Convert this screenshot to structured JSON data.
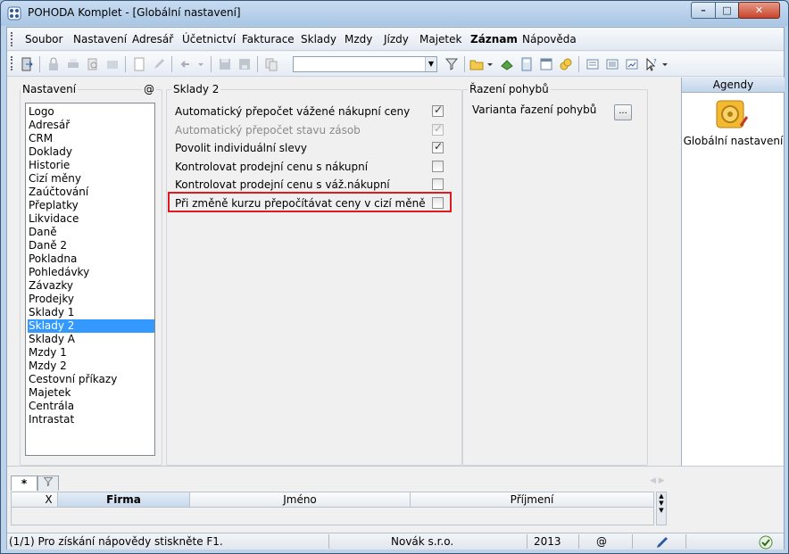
{
  "window": {
    "title": "POHODA Komplet - [Globální nastavení]",
    "controls": {
      "minimize": "–",
      "maximize": "□",
      "close": "✕"
    }
  },
  "menu": [
    {
      "label": "Soubor"
    },
    {
      "label": "Nastavení"
    },
    {
      "label": "Adresář"
    },
    {
      "label": "Účetnictví"
    },
    {
      "label": "Fakturace"
    },
    {
      "label": "Sklady"
    },
    {
      "label": "Mzdy"
    },
    {
      "label": "Jízdy"
    },
    {
      "label": "Majetek"
    },
    {
      "label": "Záznam"
    },
    {
      "label": "Nápověda"
    }
  ],
  "toolbar": {
    "combo_value": ""
  },
  "nastaveni": {
    "group_label": "Nastavení",
    "at_symbol": "@",
    "items": [
      "Logo",
      "Adresář",
      "CRM",
      "Doklady",
      "Historie",
      "Cizí měny",
      "Zaúčtování",
      "Přeplatky",
      "Likvidace",
      "Daně",
      "Daně 2",
      "Pokladna",
      "Pohledávky",
      "Závazky",
      "Prodejky",
      "Sklady 1",
      "Sklady 2",
      "Sklady A",
      "Mzdy 1",
      "Mzdy 2",
      "Cestovní příkazy",
      "Majetek",
      "Centrála",
      "Intrastat"
    ],
    "selected": "Sklady 2"
  },
  "sklady2": {
    "group_label": "Sklady 2",
    "options": [
      {
        "label": "Automatický přepočet vážené nákupní ceny",
        "checked": true,
        "disabled": false
      },
      {
        "label": "Automatický přepočet stavu zásob",
        "checked": true,
        "disabled": true
      },
      {
        "label": "Povolit individuální slevy",
        "checked": true,
        "disabled": false
      },
      {
        "label": "Kontrolovat prodejní cenu s nákupní",
        "checked": false,
        "disabled": false
      },
      {
        "label": "Kontrolovat prodejní cenu s váž.nákupní",
        "checked": false,
        "disabled": false
      },
      {
        "label": "Při změně kurzu přepočítávat ceny v cizí měně",
        "checked": false,
        "disabled": false
      }
    ]
  },
  "razeni": {
    "group_label": "Řazení pohybů",
    "variant_label": "Varianta řazení pohybů",
    "button_label": "..."
  },
  "agendy": {
    "header": "Agendy",
    "item_label": "Globální nastavení"
  },
  "bottom": {
    "tab_star": "*",
    "columns": [
      "X",
      "Firma",
      "Jméno",
      "Příjmení"
    ]
  },
  "status": {
    "help": "(1/1) Pro získání nápovědy stiskněte F1.",
    "user": "Novák s.r.o.",
    "year": "2013",
    "at": "@"
  },
  "colors": {
    "selection": "#3399ff",
    "highlight_border": "#e01a22"
  }
}
